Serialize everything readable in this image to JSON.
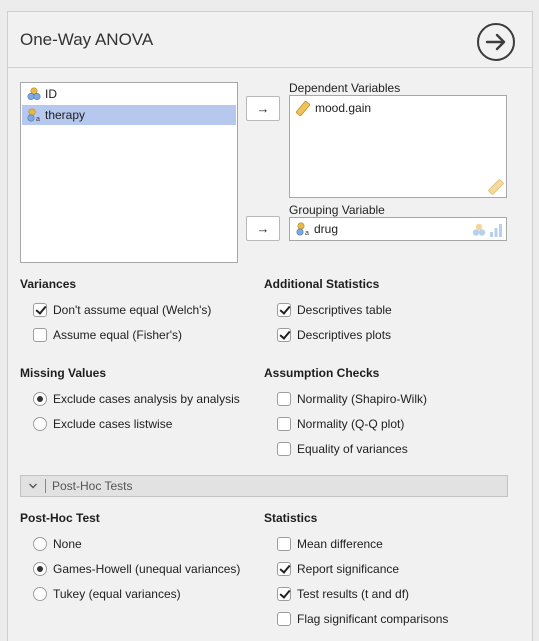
{
  "title": "One-Way ANOVA",
  "variables": [
    {
      "label": "ID",
      "icon": "nominal-icon",
      "selected": false
    },
    {
      "label": "therapy",
      "icon": "nominal-text-icon",
      "selected": true
    }
  ],
  "dependent": {
    "label": "Dependent Variables",
    "items": [
      "mood.gain"
    ]
  },
  "grouping": {
    "label": "Grouping Variable",
    "value": "drug"
  },
  "variances": {
    "label": "Variances",
    "welch": "Don't assume equal (Welch's)",
    "fisher": "Assume equal (Fisher's)"
  },
  "additional": {
    "label": "Additional Statistics",
    "desc_table": "Descriptives table",
    "desc_plots": "Descriptives plots"
  },
  "missing": {
    "label": "Missing Values",
    "analysis": "Exclude cases analysis by analysis",
    "listwise": "Exclude cases listwise"
  },
  "assumption": {
    "label": "Assumption Checks",
    "shapiro": "Normality (Shapiro-Wilk)",
    "qq": "Normality (Q-Q plot)",
    "equality": "Equality of variances"
  },
  "posthoc_section": "Post-Hoc Tests",
  "posthoc": {
    "label": "Post-Hoc Test",
    "none": "None",
    "games": "Games-Howell (unequal variances)",
    "tukey": "Tukey (equal variances)"
  },
  "statistics": {
    "label": "Statistics",
    "mean_diff": "Mean difference",
    "report_sig": "Report significance",
    "test_results": "Test results (t and df)",
    "flag_sig": "Flag significant comparisons"
  }
}
